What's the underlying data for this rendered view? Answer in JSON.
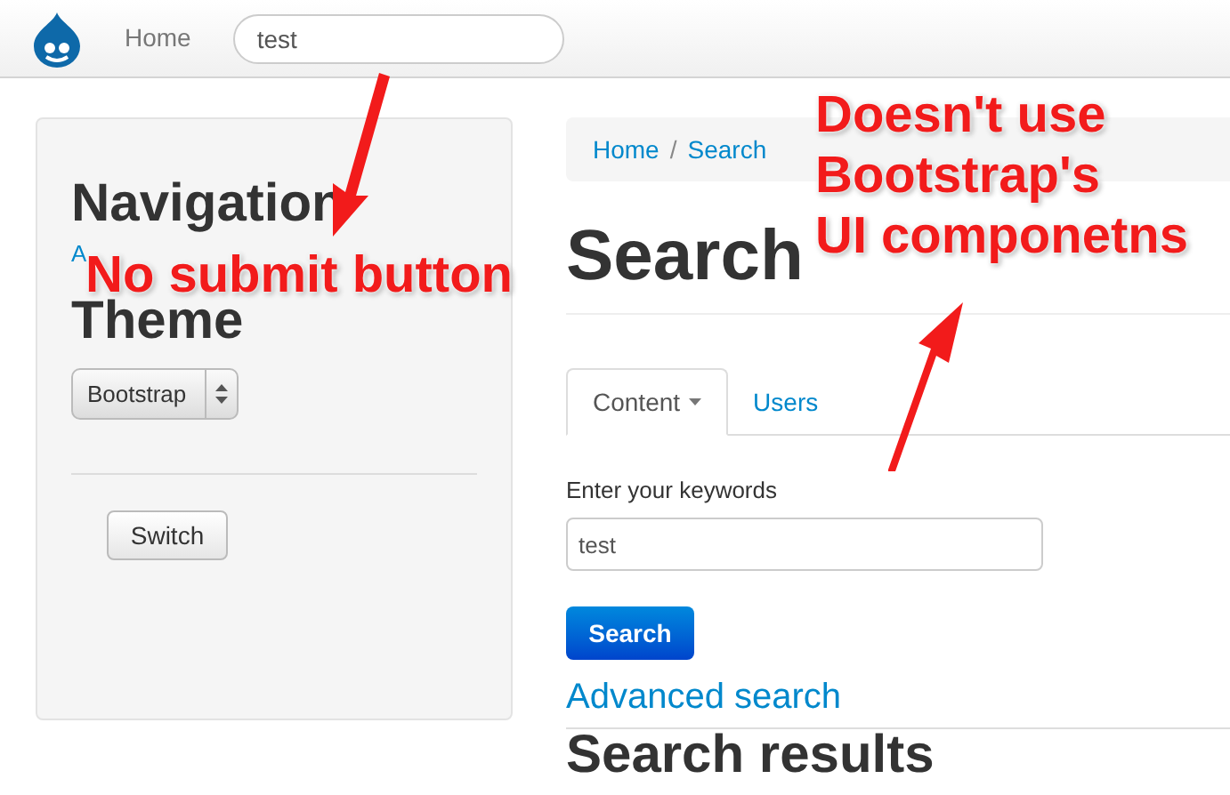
{
  "navbar": {
    "home_link": "Home",
    "search_field": {
      "value": "test"
    }
  },
  "sidebar": {
    "navigation_heading": "Navigation",
    "navigation_link": "A",
    "theme_heading": "Theme",
    "theme_select": {
      "value": "Bootstrap"
    },
    "switch_button": "Switch"
  },
  "breadcrumb": [
    {
      "label": "Home"
    },
    {
      "label": "Search"
    }
  ],
  "breadcrumb_separator": "/",
  "page_title": "Search",
  "tabs": [
    {
      "label": "Content",
      "selected": true,
      "dropdown": true
    },
    {
      "label": "Users",
      "selected": false,
      "dropdown": false
    }
  ],
  "search_form": {
    "label": "Enter your keywords",
    "value": "test",
    "button": "Search",
    "advanced_link": "Advanced search"
  },
  "results_heading": "Search results",
  "annotations": [
    {
      "lines": [
        "No submit button"
      ]
    },
    {
      "lines": [
        "Doesn't use",
        "Bootstrap's",
        "UI componetns"
      ]
    }
  ]
}
